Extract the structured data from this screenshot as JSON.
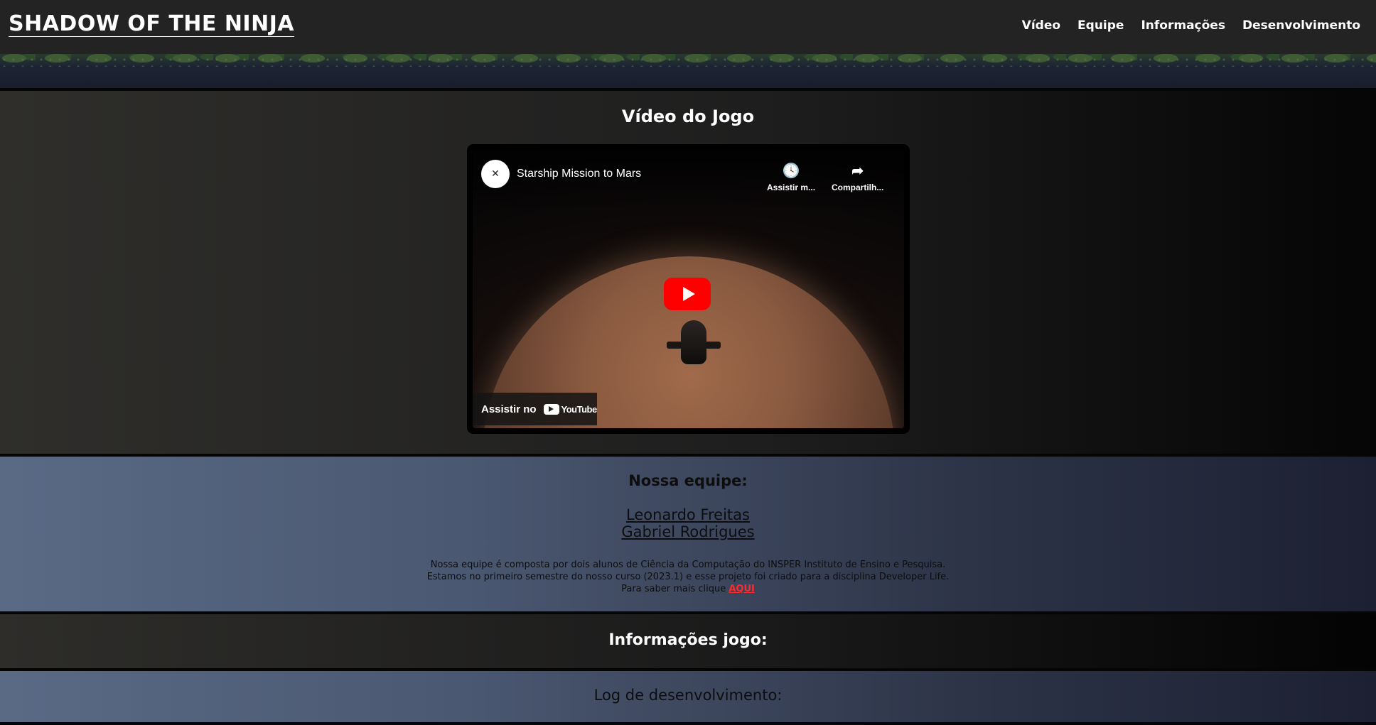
{
  "header": {
    "site_title": "SHADOW OF THE NINJA",
    "nav": [
      "Vídeo",
      "Equipe",
      "Informações",
      "Desenvolvimento"
    ]
  },
  "video_section": {
    "title": "Vídeo do Jogo",
    "player": {
      "video_title": "Starship Mission to Mars",
      "actions": [
        {
          "icon": "clock-icon",
          "label": "Assistir m..."
        },
        {
          "icon": "share-icon",
          "label": "Compartilh..."
        }
      ],
      "watch_on_label": "Assistir no",
      "yt_logo_text": "YouTube"
    }
  },
  "team_section": {
    "title": "Nossa equipe:",
    "members": [
      "Leonardo Freitas",
      "Gabriel Rodrigues"
    ],
    "description_lines": [
      "Nossa equipe é composta por dois alunos de Ciência da Computação do INSPER Instituto de Ensino e Pesquisa.",
      "Estamos no primeiro semestre do nosso curso (2023.1) e esse projeto foi criado para a disciplina Developer Life."
    ],
    "more_prefix": "Para saber mais clique",
    "more_link": "AQUI"
  },
  "info_section": {
    "title": "Informações jogo:"
  },
  "log_section": {
    "title": "Log de desenvolvimento:"
  }
}
